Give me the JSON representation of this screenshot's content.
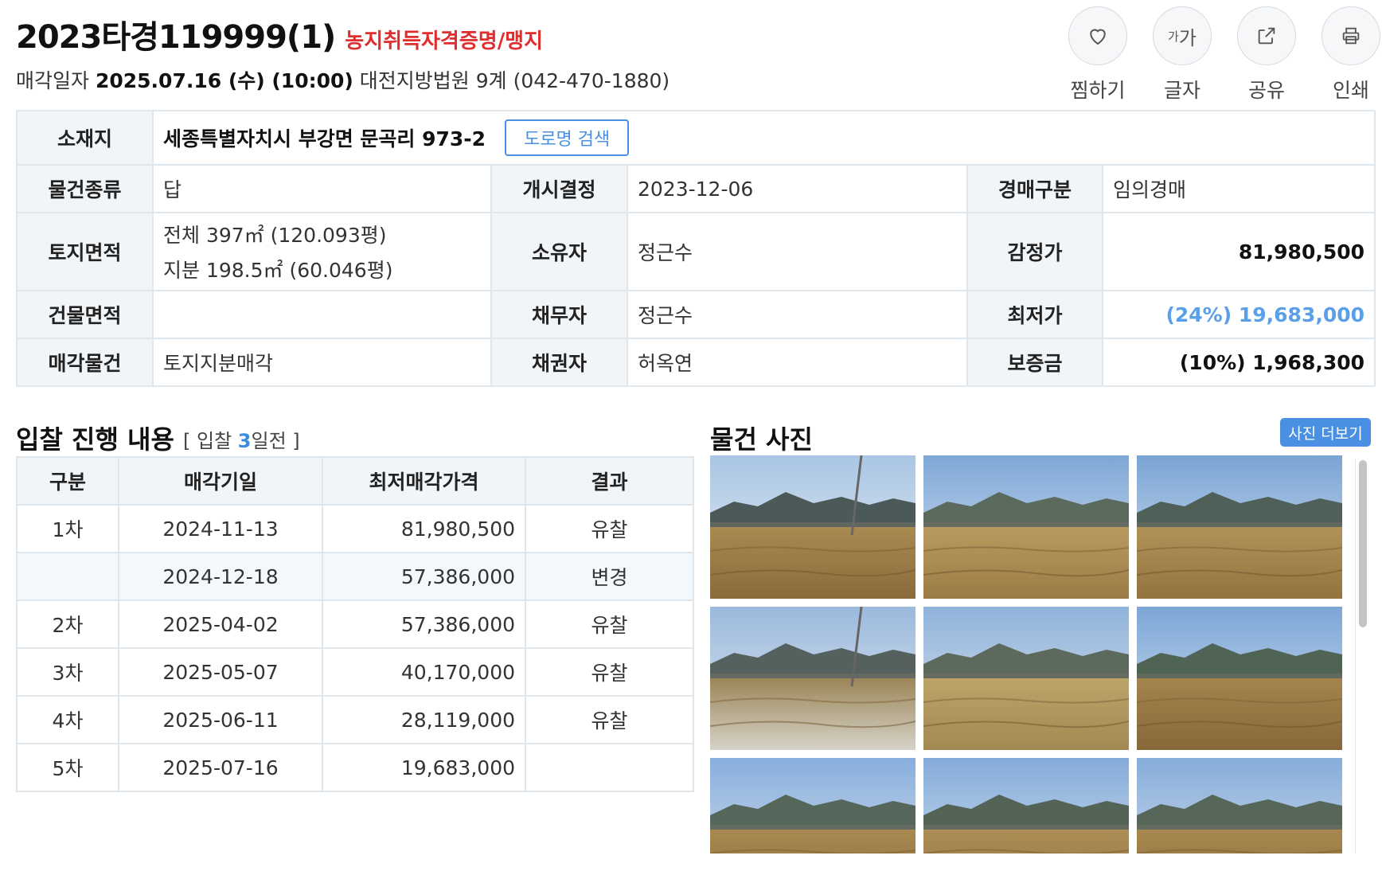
{
  "header": {
    "case_no": "2023타경119999(1)",
    "tag": "농지취득자격증명/맹지",
    "sale_prefix": "매각일자",
    "sale_datetime": "2025.07.16 (수) (10:00)",
    "court": "대전지방법원 9계 (042-470-1880)"
  },
  "actions": [
    {
      "label": "찜하기",
      "icon": "heart-icon"
    },
    {
      "label": "글자",
      "icon": "font-size-icon",
      "glyph_small": "가",
      "glyph_large": "가"
    },
    {
      "label": "공유",
      "icon": "share-icon"
    },
    {
      "label": "인쇄",
      "icon": "print-icon"
    }
  ],
  "info": {
    "location_label": "소재지",
    "location_value": "세종특별자치시 부강면 문곡리 973-2",
    "road_search_label": "도로명 검색",
    "rows": [
      [
        {
          "k": "물건종류",
          "v": "답"
        },
        {
          "k": "개시결정",
          "v": "2023-12-06"
        },
        {
          "k": "경매구분",
          "v": "임의경매"
        }
      ],
      [
        {
          "k": "토지면적",
          "v1": "전체 397㎡ (120.093평)",
          "v2": "지분 198.5㎡ (60.046평)"
        },
        {
          "k": "소유자",
          "v": "정근수"
        },
        {
          "k": "감정가",
          "v": "81,980,500"
        }
      ],
      [
        {
          "k": "건물면적",
          "v": ""
        },
        {
          "k": "채무자",
          "v": "정근수"
        },
        {
          "k": "최저가",
          "v": "(24%) 19,683,000"
        }
      ],
      [
        {
          "k": "매각물건",
          "v": "토지지분매각"
        },
        {
          "k": "채권자",
          "v": "허옥연"
        },
        {
          "k": "보증금",
          "v": "(10%) 1,968,300"
        }
      ]
    ]
  },
  "bid": {
    "title": "입찰 진행 내용",
    "sub_open": "[ 입찰 ",
    "sub_days": "3",
    "sub_close": "일전 ]",
    "headers": [
      "구분",
      "매각기일",
      "최저매각가격",
      "결과"
    ],
    "rows": [
      {
        "round": "1차",
        "date": "2024-11-13",
        "price": "81,980,500",
        "result": "유찰"
      },
      {
        "round": "",
        "date": "2024-12-18",
        "price": "57,386,000",
        "result": "변경"
      },
      {
        "round": "2차",
        "date": "2025-04-02",
        "price": "57,386,000",
        "result": "유찰"
      },
      {
        "round": "3차",
        "date": "2025-05-07",
        "price": "40,170,000",
        "result": "유찰"
      },
      {
        "round": "4차",
        "date": "2025-06-11",
        "price": "28,119,000",
        "result": "유찰"
      },
      {
        "round": "5차",
        "date": "2025-07-16",
        "price": "19,683,000",
        "result": ""
      }
    ]
  },
  "photos": {
    "title": "물건 사진",
    "more_label": "사진 더보기",
    "count": 9
  },
  "colors": {
    "accent": "#4a90e2",
    "tag_red": "#e02d2d",
    "low_price": "#5a9fe8",
    "key_bg": "#f2f5f8",
    "border": "#dfe6ec"
  }
}
